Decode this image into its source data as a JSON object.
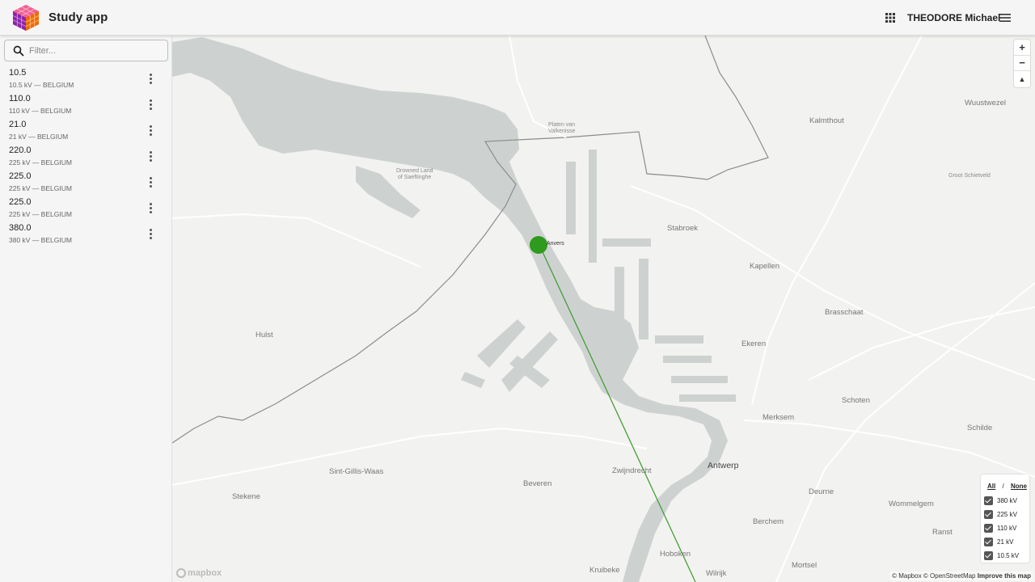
{
  "appbar": {
    "title": "Study app",
    "user": "THEODORE Michael",
    "apps_icon": "apps-grid-icon",
    "menu_icon": "hamburger-menu-icon",
    "logo_icon": "cube-logo-icon"
  },
  "sidebar": {
    "filter_placeholder": "Filter...",
    "items": [
      {
        "title": "10.5",
        "subtitle": "10.5 kV — BELGIUM"
      },
      {
        "title": "110.0",
        "subtitle": "110 kV — BELGIUM"
      },
      {
        "title": "21.0",
        "subtitle": "21 kV — BELGIUM"
      },
      {
        "title": "220.0",
        "subtitle": "225 kV — BELGIUM"
      },
      {
        "title": "225.0",
        "subtitle": "225 kV — BELGIUM"
      },
      {
        "title": "225.0",
        "subtitle": "225 kV — BELGIUM"
      },
      {
        "title": "380.0",
        "subtitle": "380 kV — BELGIUM"
      }
    ]
  },
  "map": {
    "zoom_in": "+",
    "zoom_out": "−",
    "reset_north": "▲",
    "substation_label": "Anvers",
    "line_color": "#3a9a2a",
    "substation_color": "#2e9a1e",
    "places": {
      "kalmthout": "Kalmthout",
      "wuustwezel": "Wuustwezel",
      "groot_schietveld": "Groot Schietveld",
      "stabroek": "Stabroek",
      "kapellen": "Kapellen",
      "brasschaat": "Brasschaat",
      "ekeren": "Ekeren",
      "hulst": "Hulst",
      "schoten": "Schoten",
      "merksem": "Merksem",
      "schilde": "Schilde",
      "antwerp": "Antwerp",
      "sint_gillis": "Sint-Gillis-Waas",
      "zwijndrecht": "Zwijndrecht",
      "beveren": "Beveren",
      "stekene": "Stekene",
      "deurne": "Deurne",
      "wommelgem": "Wommelgem",
      "berchem": "Berchem",
      "ranst": "Ranst",
      "hoboken": "Hoboken",
      "mortsel": "Mortsel",
      "kruibeke": "Kruibeke",
      "wilrijk": "Wilrijk",
      "drowned_land_1": "Drowned Land",
      "drowned_land_2": "of Saeftinghe",
      "platen_1": "Platen van",
      "platen_2": "Valkenisse"
    }
  },
  "legend": {
    "all": "All",
    "separator": "/",
    "none": "None",
    "items": [
      "380 kV",
      "225 kV",
      "110 kV",
      "21 kV",
      "10.5 kV"
    ]
  },
  "attribution": {
    "text": "© Mapbox © OpenStreetMap",
    "improve": "Improve this map",
    "mapbox_logo": "mapbox"
  }
}
